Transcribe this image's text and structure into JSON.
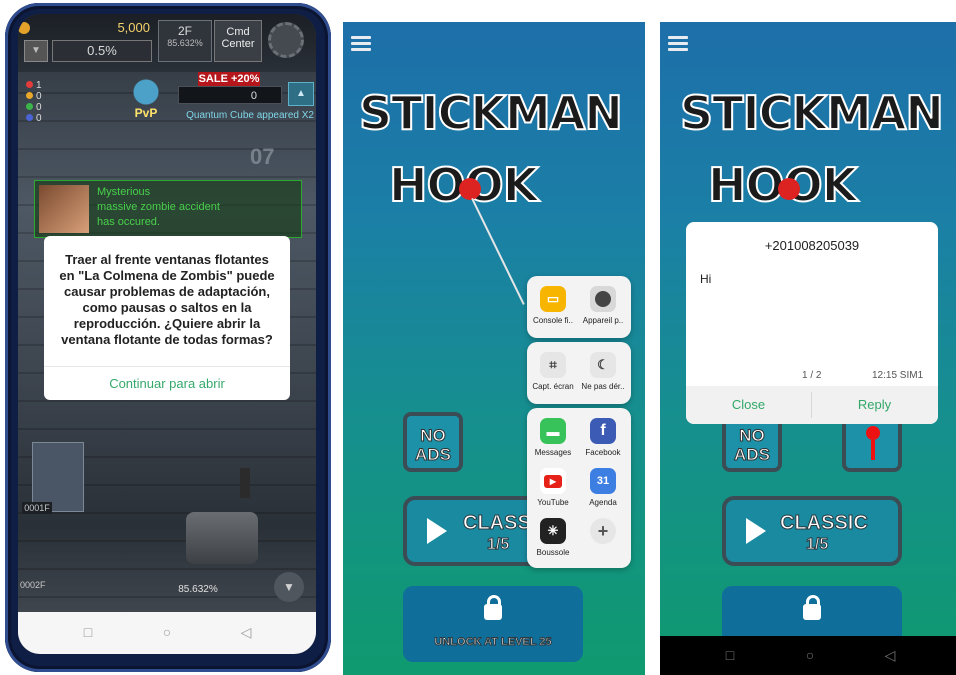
{
  "game": {
    "gold": "5,000",
    "percent": "0.5%",
    "floor_label": "2F",
    "floor_percent": "85.632%",
    "cmd_label_1": "Cmd",
    "cmd_label_2": "Center",
    "counters": [
      "1",
      "0",
      "0",
      "0"
    ],
    "counter_colors": [
      "#e33b3b",
      "#e9a829",
      "#3bb54a",
      "#4a64d6"
    ],
    "pvp": "PvP",
    "sale": "SALE  +20%",
    "cube_count": "0",
    "cube_message": "Quantum Cube appeared X2",
    "wall_number": "07",
    "notification_lines": [
      "Mysterious",
      "massive zombie accident",
      "has occured."
    ],
    "floor_tag": "0001F",
    "floor_tag_2": "0002F",
    "bottom_percent": "85.632%",
    "dialog_message": "Traer al frente ventanas flotantes en \"La Colmena de Zombis\" puede causar problemas de adaptación, como pausas o saltos en la reproducción. ¿Quiere abrir la ventana flotante de todas formas?",
    "dialog_button": "Continuar para abrir"
  },
  "stickman": {
    "title_1": "STICKMAN",
    "title_2": "HOOK",
    "noads_1": "NO",
    "noads_2": "ADS",
    "classic_label": "CLASSIC",
    "classic_progress": "1/5",
    "classic_partial": "CLASS",
    "unlock_label": "UNLOCK AT LEVEL 25"
  },
  "app_menu": {
    "group1": [
      {
        "label": "Console fi..",
        "icon": "folder-icon",
        "color": "#f7b500"
      },
      {
        "label": "Appareil p..",
        "icon": "camera-icon",
        "color": "#4a4a4a"
      }
    ],
    "group2": [
      {
        "label": "Capt. écran",
        "icon": "crop-icon",
        "color": "#e6e6e6"
      },
      {
        "label": "Ne pas dér..",
        "icon": "do-not-disturb-icon",
        "color": "#e6e6e6"
      }
    ],
    "group3": [
      {
        "label": "Messages",
        "icon": "message-icon",
        "color": "#38c25a"
      },
      {
        "label": "Facebook",
        "icon": "facebook-icon",
        "color": "#3b5bb5"
      },
      {
        "label": "YouTube",
        "icon": "youtube-icon",
        "color": "#ffffff"
      },
      {
        "label": "Agenda",
        "icon": "calendar-icon",
        "color": "#3d7ee3"
      },
      {
        "label": "Boussole",
        "icon": "compass-icon",
        "color": "#222222"
      },
      {
        "label": "",
        "icon": "add-icon",
        "color": "#e6e6e6"
      }
    ],
    "agenda_day": "31"
  },
  "sms": {
    "number": "+201008205039",
    "body": "Hi",
    "page": "1 / 2",
    "time": "12:15  SIM1",
    "close": "Close",
    "reply": "Reply"
  }
}
